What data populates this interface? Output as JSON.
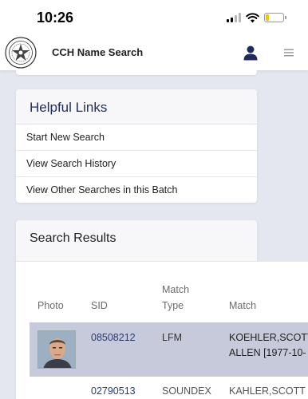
{
  "status_bar": {
    "time": "10:26"
  },
  "header": {
    "title": "CCH Name Search"
  },
  "helpful_links": {
    "title": "Helpful Links",
    "items": [
      "Start New Search",
      "View Search History",
      "View Other Searches in this Batch"
    ]
  },
  "results": {
    "title": "Search Results",
    "columns": {
      "photo": "Photo",
      "sid": "SID",
      "match_type_1": "Match",
      "match_type_2": "Type",
      "match": "Match"
    },
    "rows": [
      {
        "sid": "08508212",
        "match_type": "LFM",
        "match_line1": "KOEHLER,SCOTT",
        "match_line2": "ALLEN [1977-10-"
      },
      {
        "sid": "02790513",
        "match_type": "SOUNDEX",
        "match_line1": "KAHLER,SCOTT"
      }
    ]
  },
  "colors": {
    "accent": "#1f2b5c",
    "selected_row": "#c7cada",
    "background": "#e4e7ef"
  }
}
